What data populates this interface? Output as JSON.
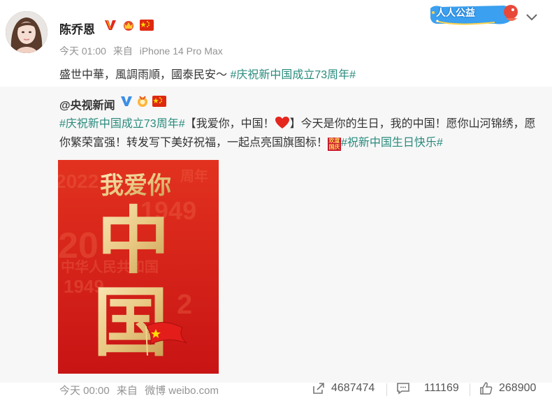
{
  "post": {
    "username": "陈乔恩",
    "badges": [
      "v-badge-icon",
      "crown-icon",
      "china-flag-icon"
    ],
    "time": "今天 01:00",
    "source_prefix": "来自",
    "source": "iPhone 14 Pro Max",
    "text": "盛世中華，風調雨順，國泰民安～ ",
    "topic": "#庆祝新中国成立73周年#",
    "promo_label": "人人公益"
  },
  "repost": {
    "author": "@央视新闻",
    "topic1": "#庆祝新中国成立73周年#",
    "text1": "【我爱你，中国！",
    "text2": "】今天是你的生日，我的中国！愿你山河锦绣，愿你繁荣富强！转发写下美好祝福，一起点亮国旗图标！",
    "emoji_badge": "欢度国庆",
    "topic2": "#祝新中国生日快乐#",
    "poster": {
      "headline": "我爱你",
      "big1": "中",
      "big2": "国",
      "bg_text": "中华人民共和国",
      "year": "1949",
      "year2": "2022",
      "bg_char": "周年"
    }
  },
  "footer": {
    "time": "今天 00:00",
    "source_prefix": "来自",
    "source": "微博 weibo.com",
    "reposts": "4687474",
    "comments": "111169",
    "likes": "268900"
  },
  "colors": {
    "topic": "#2a8b7d",
    "poster_red": "#d3201f",
    "gold": "#e8c882"
  }
}
